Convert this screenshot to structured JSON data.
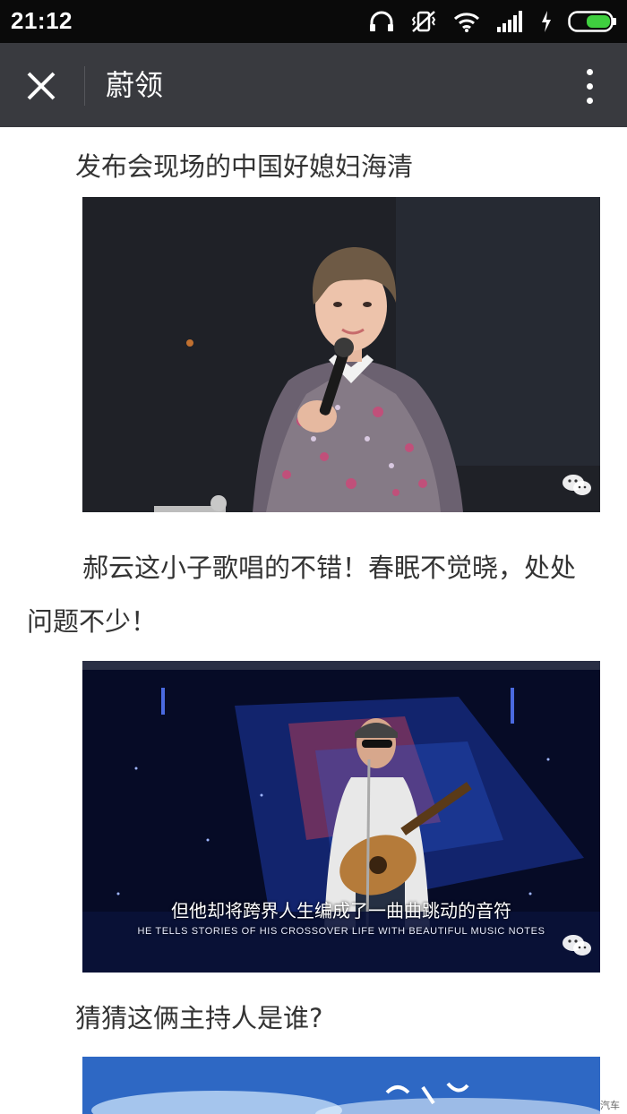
{
  "status_bar": {
    "time": "21:12",
    "icons": [
      "headphones-icon",
      "vibrate-mute-icon",
      "wifi-icon",
      "signal-icon",
      "charging-icon",
      "battery-icon"
    ]
  },
  "app_bar": {
    "title": "蔚领",
    "close_icon": "close-icon",
    "more_icon": "more-vertical-icon"
  },
  "article": {
    "caption1": "发布会现场的中国好媳妇海清",
    "paragraph2_line1": "郝云这小子歌唱的不错！春眠不觉晓，处处",
    "paragraph2_line2": "问题不少！",
    "photo2_subtitle_cn": "但他却将跨界人生编成了一曲曲跳动的音符",
    "photo2_subtitle_en": "HE TELLS STORIES OF HIS CROSSOVER LIFE WITH BEAUTIFUL MUSIC NOTES",
    "caption3": "猜猜这俩主持人是谁?",
    "watermark": "汽车"
  },
  "colors": {
    "status_bar_bg": "#0a0a0a",
    "app_bar_bg": "#393a3f",
    "text": "#333333",
    "battery_green": "#3fcf3f"
  }
}
